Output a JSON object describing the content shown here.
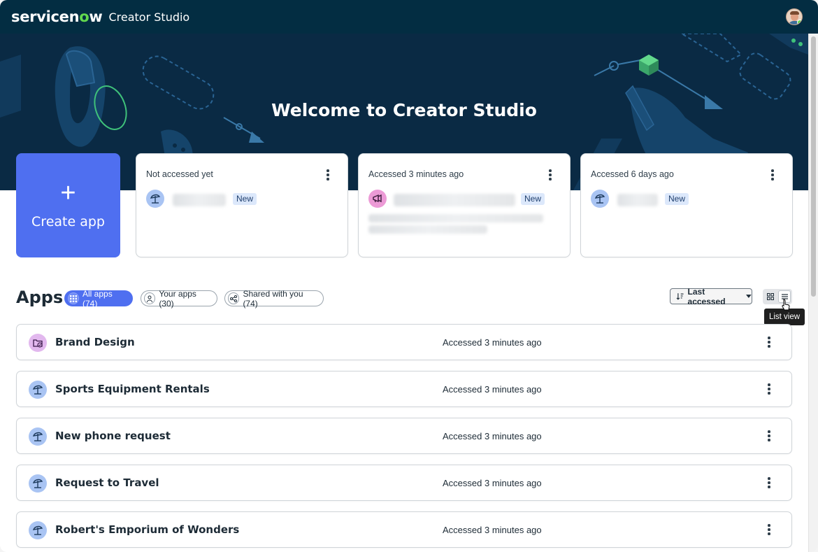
{
  "header": {
    "brand_prefix": "servicen",
    "brand_o": "o",
    "brand_suffix": "w",
    "product": "Creator Studio"
  },
  "hero": {
    "title": "Welcome to Creator Studio"
  },
  "create_card": {
    "plus": "+",
    "label": "Create app"
  },
  "recent_cards": [
    {
      "meta": "Not accessed yet",
      "badge": "New",
      "icon": "beach-umbrella-icon"
    },
    {
      "meta": "Accessed 3 minutes ago",
      "badge": "New",
      "icon": "megaphone-icon"
    },
    {
      "meta": "Accessed 6 days ago",
      "badge": "New",
      "icon": "beach-umbrella-icon"
    }
  ],
  "apps": {
    "title": "Apps",
    "filters": [
      {
        "label": "All apps (74)",
        "active": true,
        "icon": "grid-icon"
      },
      {
        "label": "Your apps (30)",
        "active": false,
        "icon": "person-icon"
      },
      {
        "label": "Shared with you (74)",
        "active": false,
        "icon": "share-icon"
      }
    ],
    "sort_label": "Last accessed",
    "tooltip": "List view",
    "items": [
      {
        "name": "Brand Design",
        "accessed": "Accessed 3 minutes ago",
        "icon": "folder-check-icon"
      },
      {
        "name": "Sports Equipment Rentals",
        "accessed": "Accessed 3 minutes ago",
        "icon": "beach-umbrella-icon"
      },
      {
        "name": "New phone request",
        "accessed": "Accessed 3 minutes ago",
        "icon": "beach-umbrella-icon"
      },
      {
        "name": "Request to Travel",
        "accessed": "Accessed 3 minutes ago",
        "icon": "beach-umbrella-icon"
      },
      {
        "name": "Robert's Emporium of Wonders",
        "accessed": "Accessed 3 minutes ago",
        "icon": "beach-umbrella-icon"
      }
    ]
  },
  "colors": {
    "topbar": "#032d42",
    "hero": "#0a2a44",
    "accent": "#4f6ff0",
    "brand_green": "#62d84e"
  }
}
